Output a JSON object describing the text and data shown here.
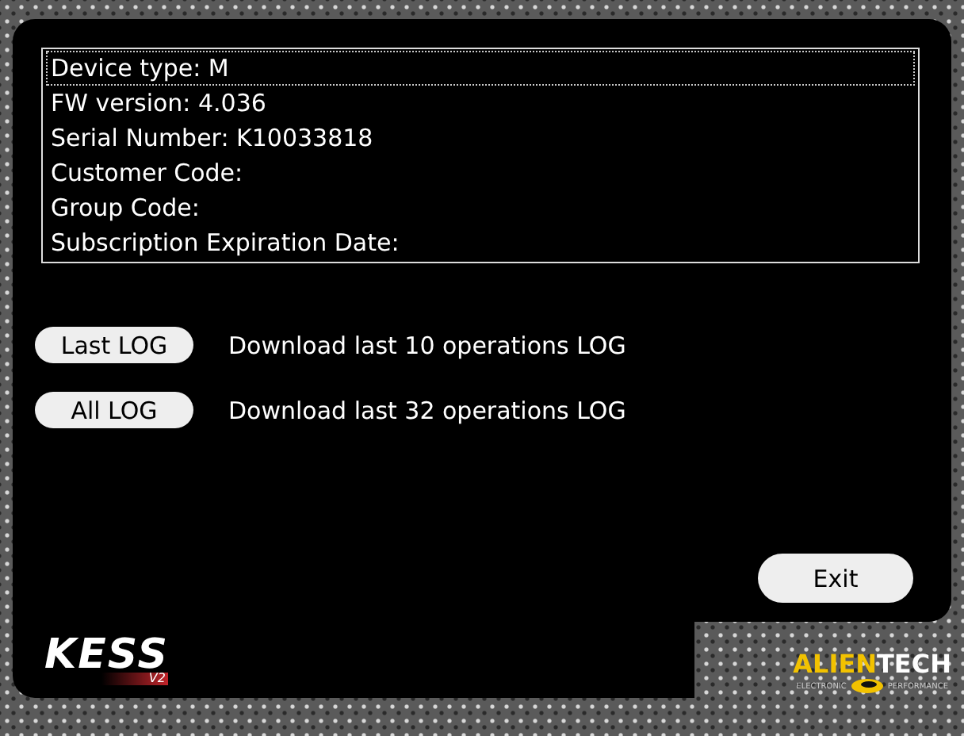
{
  "info_list": [
    {
      "text": "Device type: M",
      "selected": true
    },
    {
      "text": "FW version: 4.036",
      "selected": false
    },
    {
      "text": "Serial Number: K10033818",
      "selected": false
    },
    {
      "text": "Customer Code:",
      "selected": false
    },
    {
      "text": "Group Code:",
      "selected": false
    },
    {
      "text": "Subscription Expiration Date:",
      "selected": false
    }
  ],
  "log_actions": [
    {
      "button": "Last LOG",
      "description": "Download last 10 operations LOG"
    },
    {
      "button": "All LOG",
      "description": "Download last 32 operations LOG"
    }
  ],
  "exit_button": "Exit",
  "logos": {
    "product": {
      "name": "KESS",
      "version": "V2"
    },
    "brand": {
      "name_left": "ALIEN",
      "name_right": "TECH",
      "tagline_left": "ELECTRONIC",
      "tagline_right": "PERFORMANCE"
    }
  }
}
